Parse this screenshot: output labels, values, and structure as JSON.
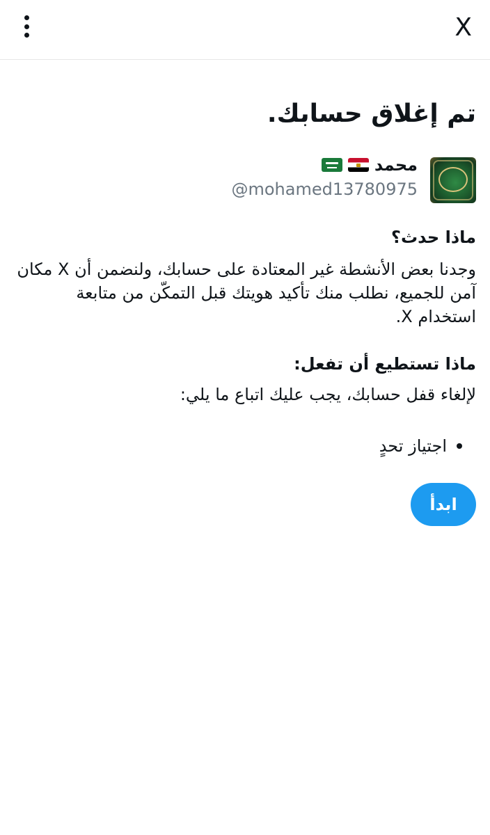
{
  "topbar": {
    "close_label": "X",
    "menu_icon": "more-vertical-icon"
  },
  "main": {
    "title": "تم إغلاق حسابك.",
    "account": {
      "display_name": "محمد",
      "handle": "@mohamed13780975",
      "flags": [
        "egypt-flag-icon",
        "saudi-flag-icon"
      ]
    },
    "what_happened": {
      "heading": "ماذا حدث؟",
      "body": "وجدنا بعض الأنشطة غير المعتادة على حسابك، ولنضمن أن X مكان آمن للجميع، نطلب منك تأكيد هويتك قبل التمكّن من متابعة استخدام X."
    },
    "what_to_do": {
      "heading": "ماذا تستطيع أن تفعل:",
      "body": "لإلغاء قفل حسابك، يجب عليك اتباع ما يلي:",
      "steps": [
        "اجتياز تحدٍ"
      ]
    },
    "start_label": "ابدأ"
  },
  "colors": {
    "accent": "#1d9bf0",
    "text": "#0f1419",
    "muted": "#6b7680"
  }
}
